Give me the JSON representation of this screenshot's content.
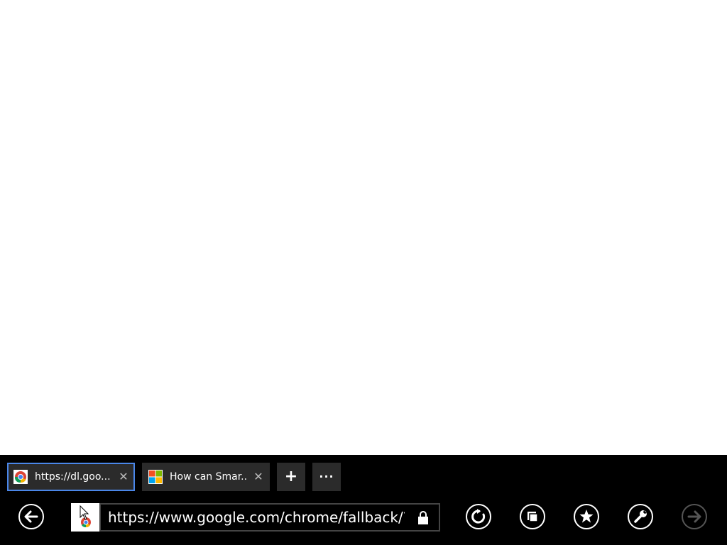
{
  "tabs": [
    {
      "title": "https://dl.goo...",
      "favicon": "chrome-icon",
      "active": true
    },
    {
      "title": "How can Smar...",
      "favicon": "windows-logo-icon",
      "active": false
    }
  ],
  "new_tab_label": "+",
  "more_label": "···",
  "address": {
    "url": "https://www.google.com/chrome/fallback/?brand=",
    "secure": true
  },
  "nav": {
    "back_icon": "back-arrow-icon",
    "refresh_icon": "refresh-icon",
    "pin_icon": "pin-to-start-icon",
    "favorites_icon": "star-icon",
    "tools_icon": "wrench-icon",
    "forward_icon": "forward-arrow-icon",
    "forward_enabled": false
  },
  "colors": {
    "app_bar": "#000000",
    "tab_bg": "#2b2b2b",
    "active_tab_border": "#4a86e8"
  }
}
